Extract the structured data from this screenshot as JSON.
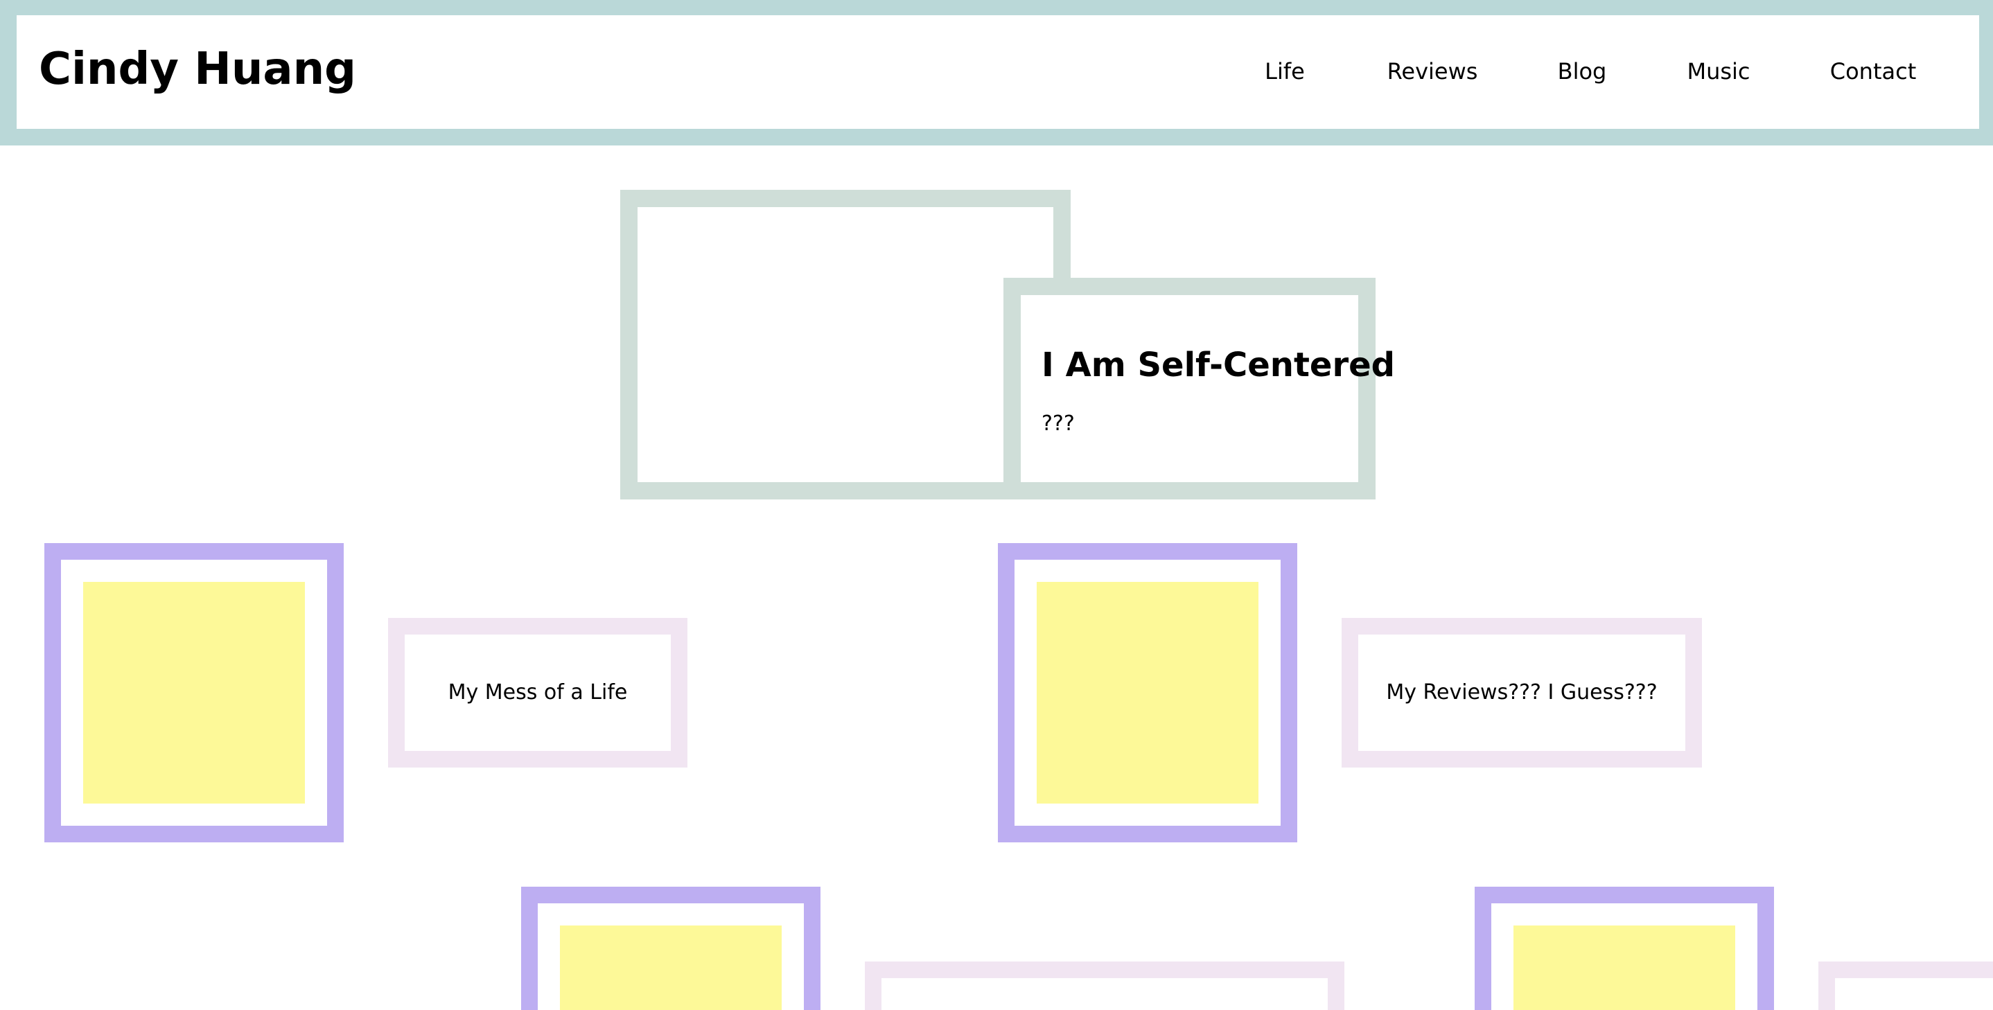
{
  "header": {
    "site_title": "Cindy Huang",
    "nav": [
      {
        "label": "Life"
      },
      {
        "label": "Reviews"
      },
      {
        "label": "Blog"
      },
      {
        "label": "Music"
      },
      {
        "label": "Contact"
      }
    ]
  },
  "hero": {
    "title": "I Am Self-Centered",
    "subtitle": "???"
  },
  "cards": [
    {
      "label": "My Mess of a Life"
    },
    {
      "label": "My Reviews??? I Guess???"
    },
    {
      "label": ""
    },
    {
      "label": ""
    }
  ],
  "colors": {
    "header_border": "#BAD8D8",
    "hero_border": "#CFDED8",
    "thumb_border": "#BDAEF2",
    "thumb_fill": "#FDF998",
    "label_border": "#F1E5F2"
  }
}
